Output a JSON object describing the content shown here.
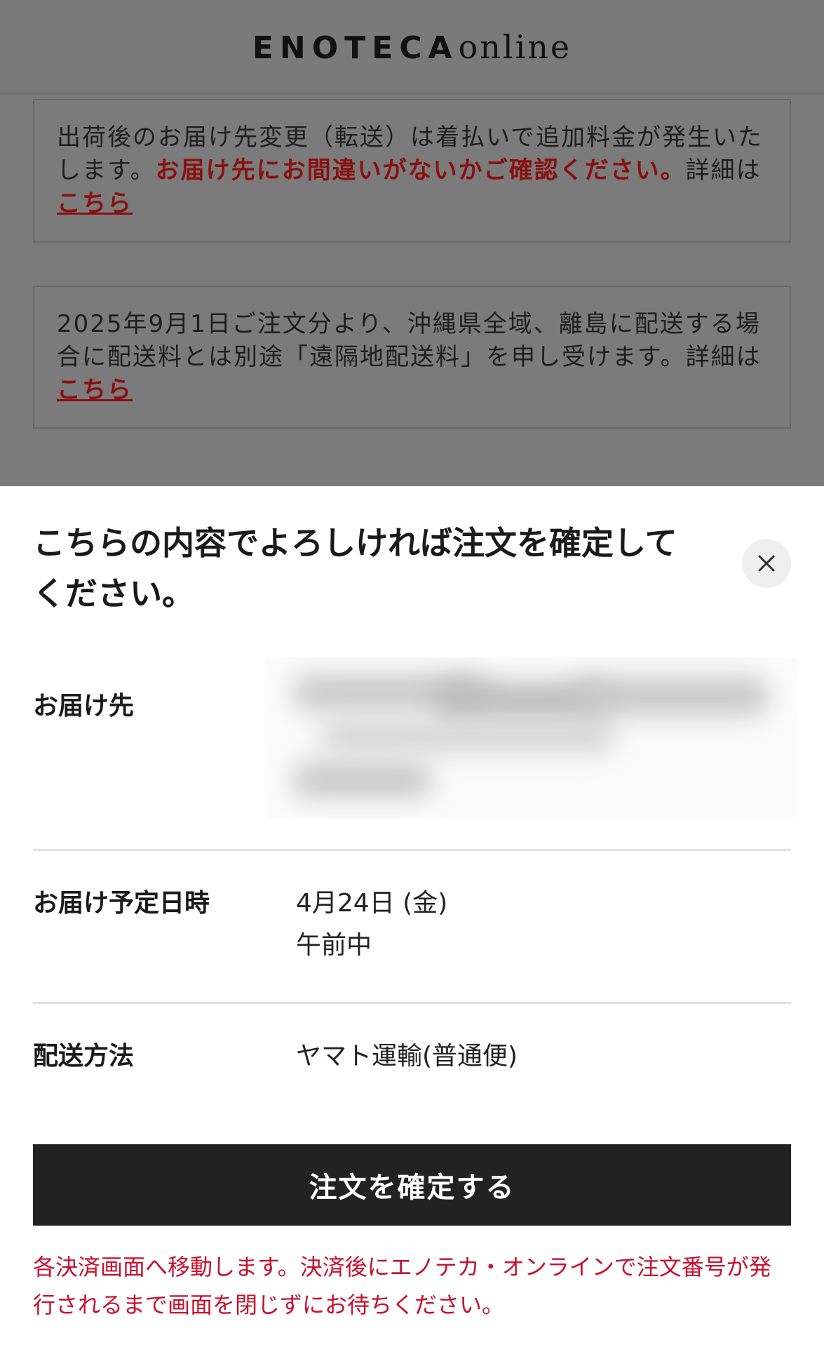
{
  "header": {
    "logo_main": "ENOTECA",
    "logo_sub": "online"
  },
  "notices": [
    {
      "text_plain": "出荷後のお届け先変更（転送）は着払いで追加料金が発生いたします。",
      "text_emphasis": "お届け先にお間違いがないかご確認ください。",
      "text_detail": "詳細は",
      "link_label": "こちら"
    },
    {
      "text_plain": "2025年9月1日ご注文分より、沖縄県全域、離島に配送する場合に配送料とは別途「遠隔地配送料」を申し受けます。",
      "text_detail": "詳細は",
      "link_label": "こちら"
    }
  ],
  "sheet": {
    "title": "こちらの内容でよろしければ注文を確定してください。",
    "close_icon": "close-icon",
    "rows": [
      {
        "label": "お届け先",
        "value_lines": []
      },
      {
        "label": "お届け予定日時",
        "value_lines": [
          "4月24日 (金)",
          "午前中"
        ]
      },
      {
        "label": "配送方法",
        "value_lines": [
          "ヤマト運輸(普通便)"
        ]
      }
    ],
    "confirm_label": "注文を確定する",
    "footnote": "各決済画面へ移動します。決済後にエノテカ・オンラインで注文番号が発行されるまで画面を閉じずにお待ちください。"
  },
  "colors": {
    "overlay": "#7b7b7b",
    "emphasis": "#8a1010",
    "footnote": "#c8102e",
    "button": "#222222"
  }
}
